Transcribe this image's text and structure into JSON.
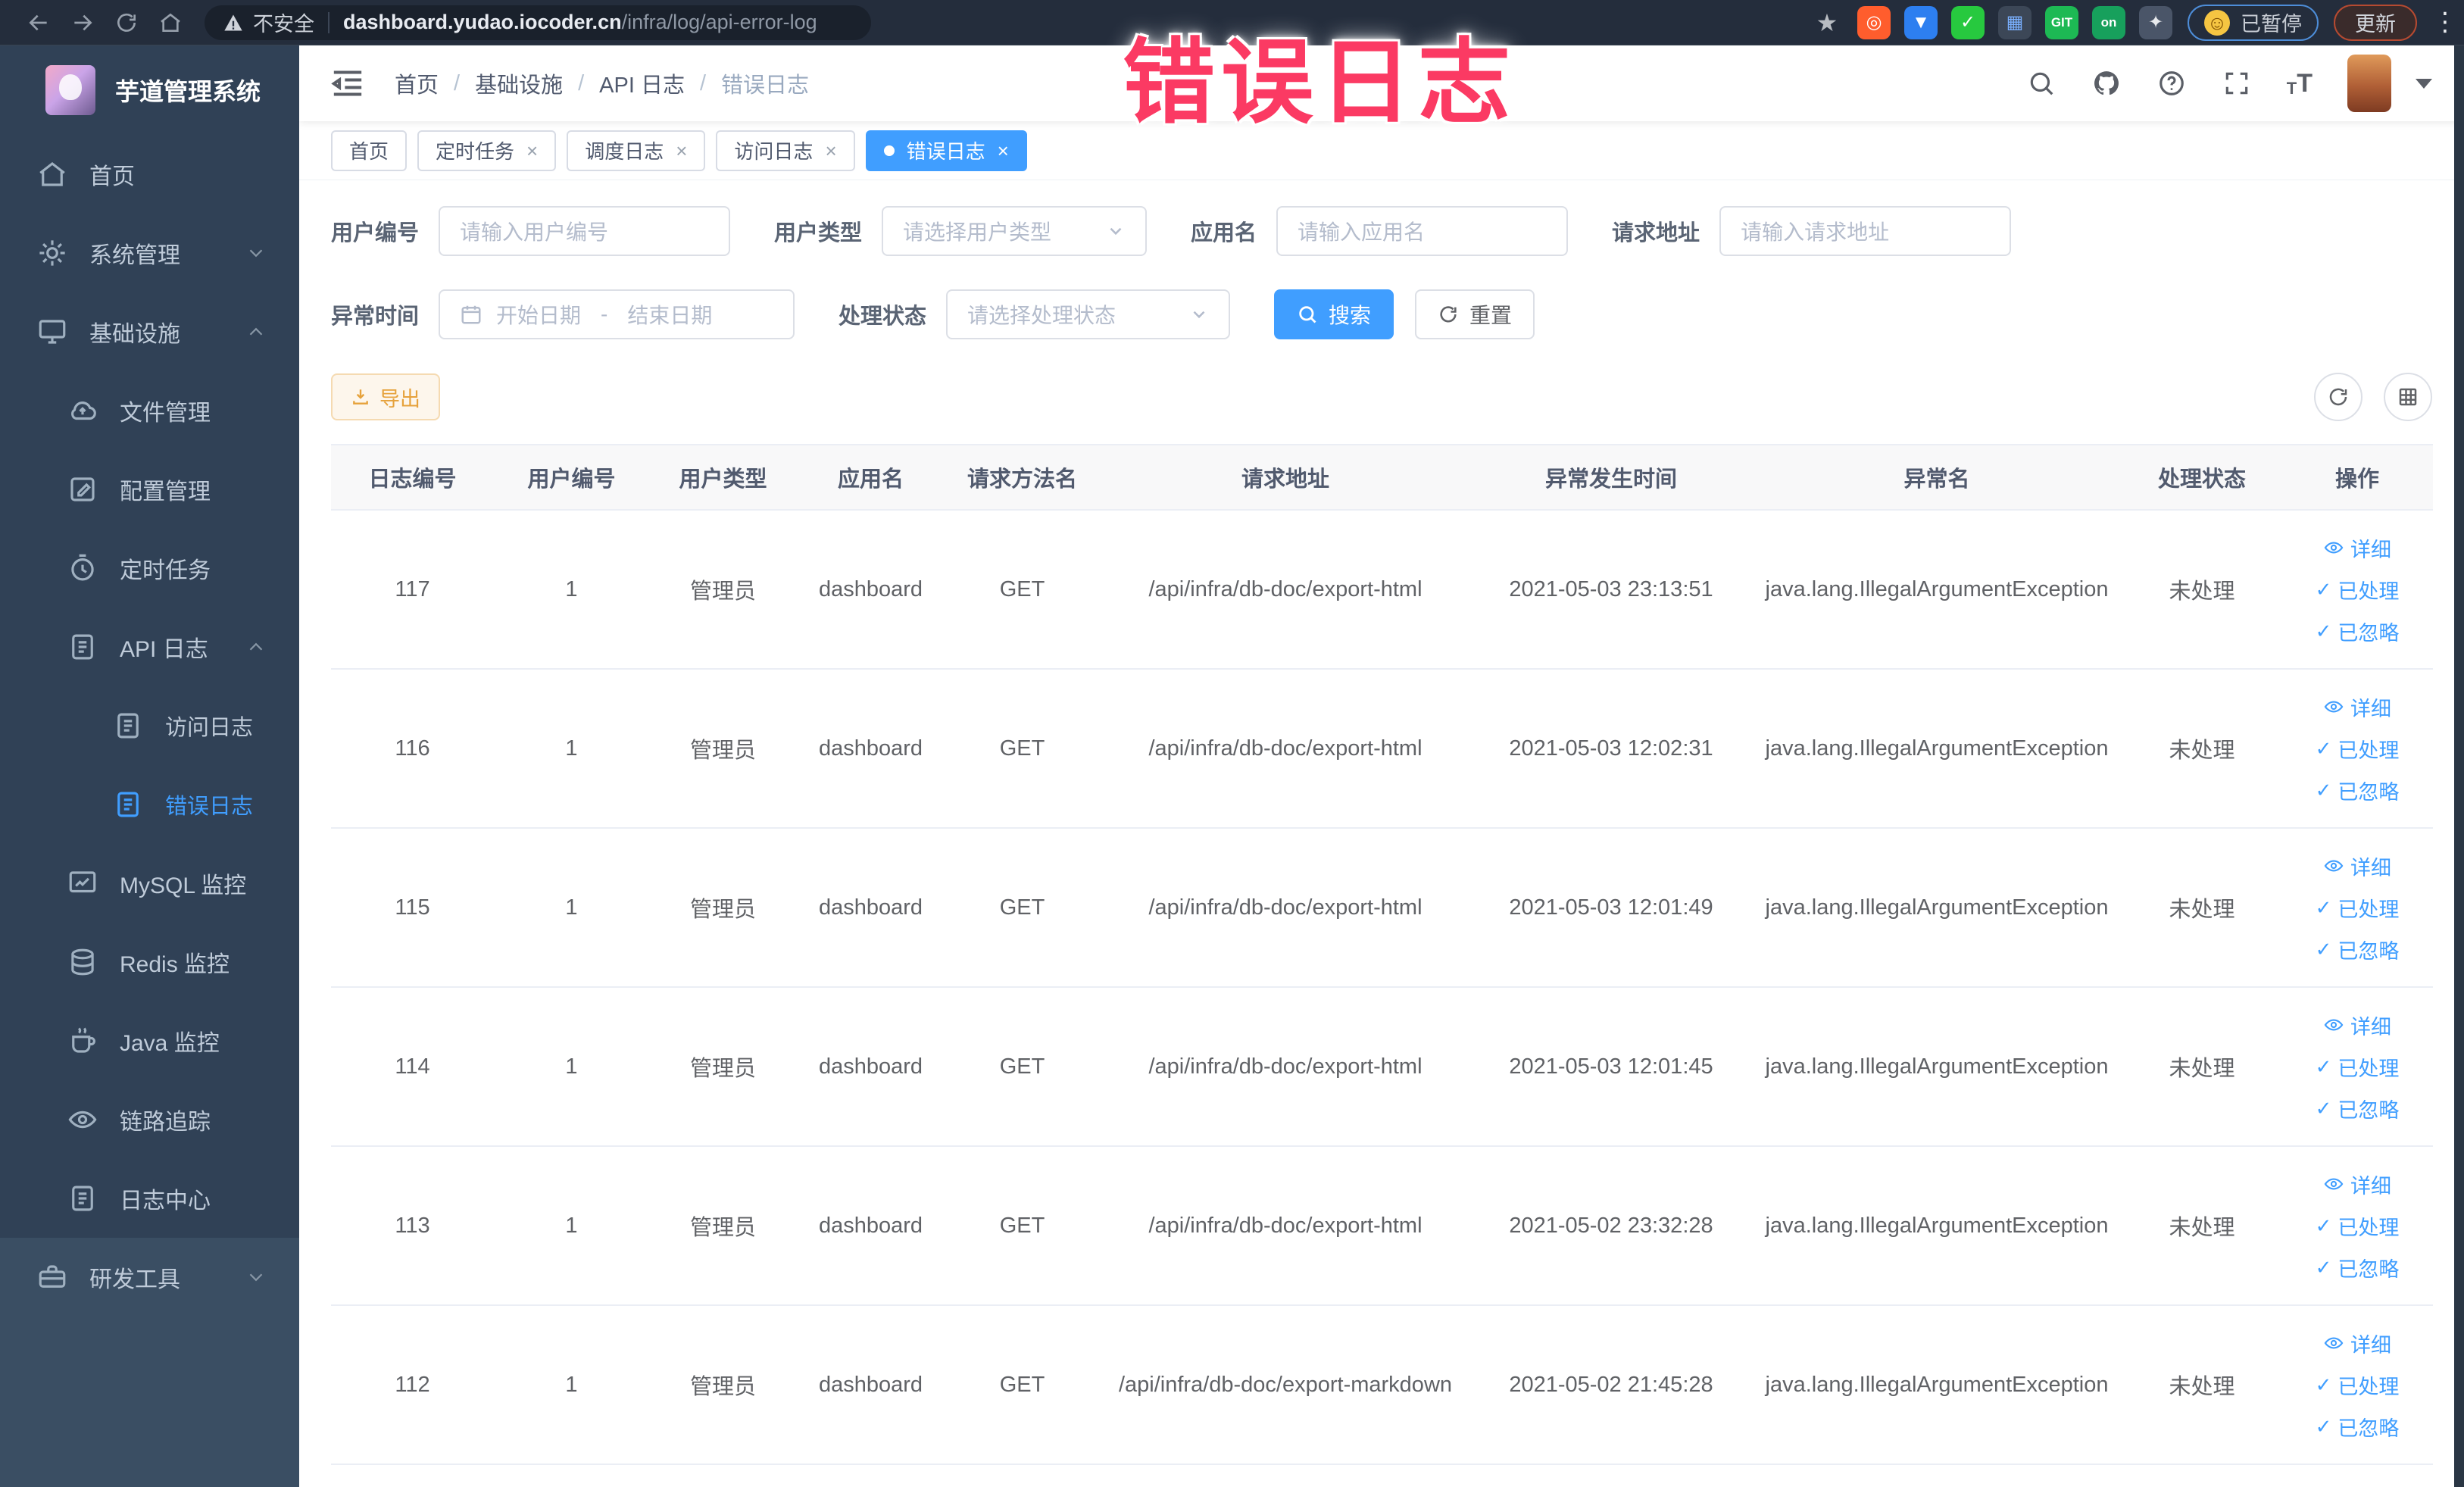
{
  "browser": {
    "security_label": "不安全",
    "url_host": "dashboard.yudao.iocoder.cn",
    "url_path": "/infra/log/api-error-log",
    "paused_label": "已暂停",
    "update_label": "更新",
    "extensions": [
      {
        "name": "bookmark-star-icon",
        "glyph": "★",
        "color": "#b8bcc2",
        "bg": "transparent"
      },
      {
        "name": "ext-orange-icon",
        "glyph": "◎",
        "color": "#ffffff",
        "bg": "#ff5d2d"
      },
      {
        "name": "ext-blue-drop-icon",
        "glyph": "▼",
        "color": "#ffffff",
        "bg": "#2d7ff0"
      },
      {
        "name": "ext-green-check-icon",
        "glyph": "✓",
        "color": "#ffffff",
        "bg": "#27c93f"
      },
      {
        "name": "ext-grid-icon",
        "glyph": "▦",
        "color": "#7ab0ff",
        "bg": "#3c4757"
      },
      {
        "name": "ext-git-icon",
        "glyph": "GIT",
        "color": "#ffffff",
        "bg": "#1db954"
      },
      {
        "name": "ext-on-badge-icon",
        "glyph": "on",
        "color": "#ffffff",
        "bg": "#17a05c"
      },
      {
        "name": "ext-paw-icon",
        "glyph": "✦",
        "color": "#e8eaed",
        "bg": "#4a5568"
      }
    ]
  },
  "overlay": {
    "text": "错误日志"
  },
  "sidebar": {
    "title": "芋道管理系统",
    "items": [
      {
        "key": "home",
        "icon": "home-icon",
        "label": "首页",
        "level": 1
      },
      {
        "key": "system-mgmt",
        "icon": "gear-icon",
        "label": "系统管理",
        "level": 1,
        "chevron": "down"
      },
      {
        "key": "infrastructure",
        "icon": "monitor-icon",
        "label": "基础设施",
        "level": 1,
        "chevron": "up"
      },
      {
        "key": "file-mgmt",
        "icon": "cloud-icon",
        "label": "文件管理",
        "level": 2
      },
      {
        "key": "config-mgmt",
        "icon": "edit-square-icon",
        "label": "配置管理",
        "level": 2
      },
      {
        "key": "scheduled-jobs",
        "icon": "timer-icon",
        "label": "定时任务",
        "level": 2
      },
      {
        "key": "api-log",
        "icon": "log-doc-icon",
        "label": "API 日志",
        "level": 2,
        "chevron": "up"
      },
      {
        "key": "access-log",
        "icon": "log-doc-icon",
        "label": "访问日志",
        "level": 3
      },
      {
        "key": "error-log",
        "icon": "log-doc-icon",
        "label": "错误日志",
        "level": 3,
        "active": true
      },
      {
        "key": "mysql-monitor",
        "icon": "chart-icon",
        "label": "MySQL 监控",
        "level": 2
      },
      {
        "key": "redis-monitor",
        "icon": "database-icon",
        "label": "Redis 监控",
        "level": 2
      },
      {
        "key": "java-monitor",
        "icon": "coffee-icon",
        "label": "Java 监控",
        "level": 2
      },
      {
        "key": "trace",
        "icon": "eye-icon",
        "label": "链路追踪",
        "level": 2
      },
      {
        "key": "log-center",
        "icon": "log-doc-icon",
        "label": "日志中心",
        "level": 2
      },
      {
        "key": "dev-tools",
        "icon": "briefcase-icon",
        "label": "研发工具",
        "level": 1,
        "chevron": "down",
        "section": "bottom"
      }
    ]
  },
  "header": {
    "breadcrumb": [
      "首页",
      "基础设施",
      "API 日志",
      "错误日志"
    ]
  },
  "tabs": [
    {
      "key": "home",
      "label": "首页",
      "closable": false,
      "active": false
    },
    {
      "key": "cron-jobs",
      "label": "定时任务",
      "closable": true,
      "active": false
    },
    {
      "key": "job-log",
      "label": "调度日志",
      "closable": true,
      "active": false
    },
    {
      "key": "access-log",
      "label": "访问日志",
      "closable": true,
      "active": false
    },
    {
      "key": "error-log",
      "label": "错误日志",
      "closable": true,
      "active": true
    }
  ],
  "filters": {
    "user_id_label": "用户编号",
    "user_id_placeholder": "请输入用户编号",
    "user_type_label": "用户类型",
    "user_type_placeholder": "请选择用户类型",
    "app_name_label": "应用名",
    "app_name_placeholder": "请输入应用名",
    "request_url_label": "请求地址",
    "request_url_placeholder": "请输入请求地址",
    "exception_time_label": "异常时间",
    "start_date_placeholder": "开始日期",
    "range_separator": "-",
    "end_date_placeholder": "结束日期",
    "process_status_label": "处理状态",
    "process_status_placeholder": "请选择处理状态",
    "search_label": "搜索",
    "reset_label": "重置"
  },
  "toolbar": {
    "export_label": "导出"
  },
  "table": {
    "columns": [
      "日志编号",
      "用户编号",
      "用户类型",
      "应用名",
      "请求方法名",
      "请求地址",
      "异常发生时间",
      "异常名",
      "处理状态",
      "操作"
    ],
    "action_labels": [
      "详细",
      "已处理",
      "已忽略"
    ],
    "rows": [
      {
        "id": "117",
        "user_id": "1",
        "user_type": "管理员",
        "app_name": "dashboard",
        "method": "GET",
        "url": "/api/infra/db-doc/export-html",
        "time": "2021-05-03 23:13:51",
        "exception": "java.lang.IllegalArgumentException",
        "status": "未处理"
      },
      {
        "id": "116",
        "user_id": "1",
        "user_type": "管理员",
        "app_name": "dashboard",
        "method": "GET",
        "url": "/api/infra/db-doc/export-html",
        "time": "2021-05-03 12:02:31",
        "exception": "java.lang.IllegalArgumentException",
        "status": "未处理"
      },
      {
        "id": "115",
        "user_id": "1",
        "user_type": "管理员",
        "app_name": "dashboard",
        "method": "GET",
        "url": "/api/infra/db-doc/export-html",
        "time": "2021-05-03 12:01:49",
        "exception": "java.lang.IllegalArgumentException",
        "status": "未处理"
      },
      {
        "id": "114",
        "user_id": "1",
        "user_type": "管理员",
        "app_name": "dashboard",
        "method": "GET",
        "url": "/api/infra/db-doc/export-html",
        "time": "2021-05-03 12:01:45",
        "exception": "java.lang.IllegalArgumentException",
        "status": "未处理"
      },
      {
        "id": "113",
        "user_id": "1",
        "user_type": "管理员",
        "app_name": "dashboard",
        "method": "GET",
        "url": "/api/infra/db-doc/export-html",
        "time": "2021-05-02 23:32:28",
        "exception": "java.lang.IllegalArgumentException",
        "status": "未处理"
      },
      {
        "id": "112",
        "user_id": "1",
        "user_type": "管理员",
        "app_name": "dashboard",
        "method": "GET",
        "url": "/api/infra/db-doc/export-markdown",
        "time": "2021-05-02 21:45:28",
        "exception": "java.lang.IllegalArgumentException",
        "status": "未处理"
      }
    ]
  }
}
